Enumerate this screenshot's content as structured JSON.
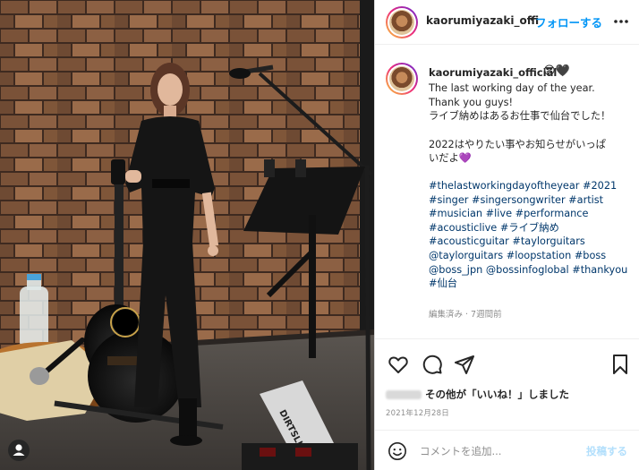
{
  "header": {
    "username": "kaorumiyazaki_offi",
    "dot": "•",
    "follow_label": "フォローする"
  },
  "caption": {
    "username": "kaorumiyazaki_official",
    "emojis": "😎🖤",
    "lines": [
      "The last working day of the year.",
      "Thank you guys!",
      "ライブ納めはあるお仕事で仙台でした！",
      "",
      "2022はやりたい事やお知らせがいっぱ",
      "いだよ💜"
    ],
    "hashtag_lines": [
      "#thelastworkingdayoftheyear #2021",
      "#singer #singersongwriter #artist",
      "#musician #live #performance",
      "#acousticlive #ライブ納め",
      "#acousticguitar #taylorguitars",
      "@taylorguitars #loopstation #boss",
      "@boss_jpn @bossinfoglobal #thankyou",
      "#仙台"
    ],
    "edited_time": "編集済み · 7週間前"
  },
  "likes": {
    "text": "その他が「いいね！」しました"
  },
  "post_date": "2021年12月28日",
  "comment": {
    "placeholder": "コメントを追加...",
    "post_label": "投稿する"
  },
  "photo": {
    "pedal_text": "DIRTSLIV"
  },
  "colors": {
    "link_blue": "#0095f6",
    "hashtag_blue": "#00376b",
    "muted": "#8e8e8e",
    "post_disabled": "#b2dffc"
  },
  "icons": [
    "more-icon",
    "heart-icon",
    "comment-icon",
    "share-icon",
    "bookmark-icon",
    "emoji-icon",
    "user-tag-icon"
  ]
}
